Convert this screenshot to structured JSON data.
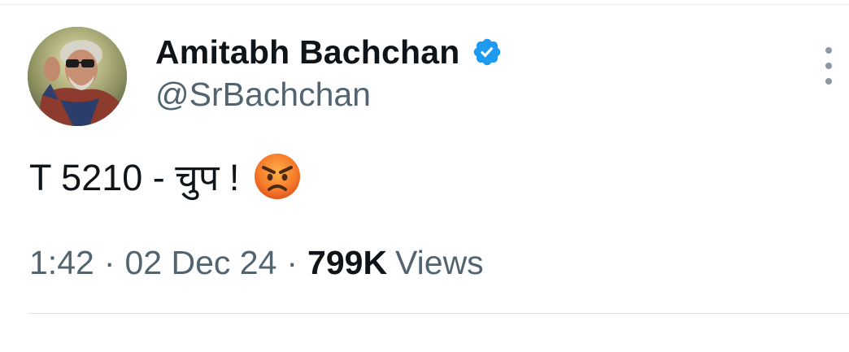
{
  "tweet": {
    "author": {
      "display_name": "Amitabh Bachchan",
      "handle": "@SrBachchan",
      "verified": true,
      "avatar_icon": "profile-photo"
    },
    "text": "T 5210 - चुप !",
    "emoji": "angry-face",
    "time": "1:42",
    "separator": "·",
    "date": "02 Dec 24",
    "views_count": "799K",
    "views_label": "Views"
  },
  "colors": {
    "text_primary": "#0f1419",
    "text_secondary": "#536471",
    "verified_blue": "#1d9bf0",
    "divider": "#e6e9ec"
  }
}
